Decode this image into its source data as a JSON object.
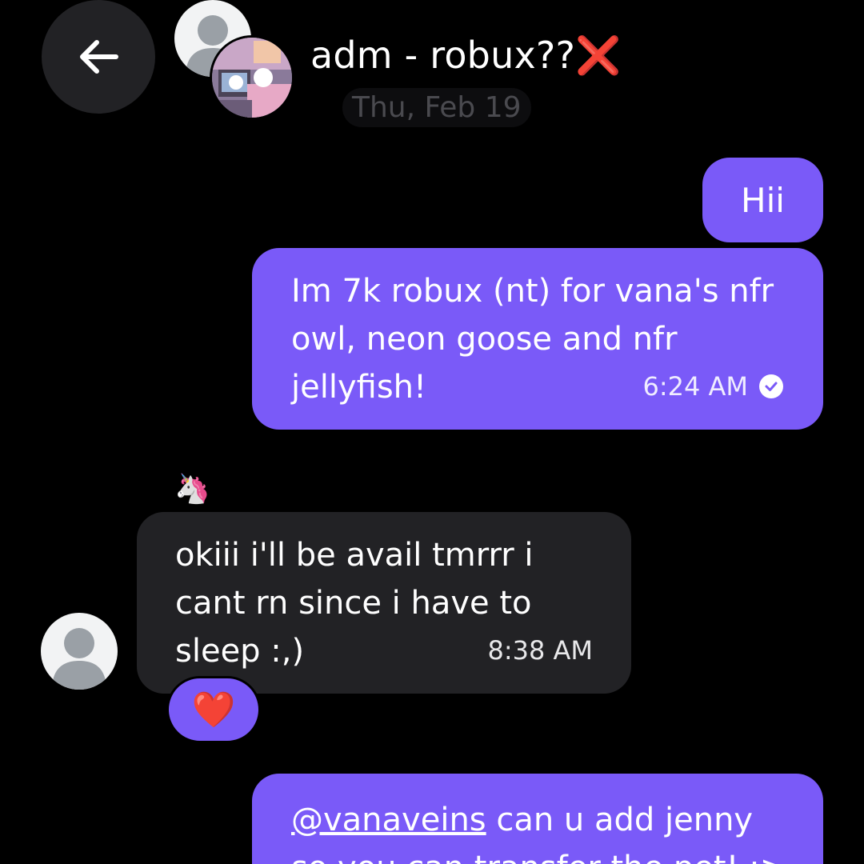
{
  "header": {
    "title": "adm - robux??",
    "title_emoji": "❌",
    "date": "Thu, Feb 19"
  },
  "messages": [
    {
      "direction": "outgoing",
      "text": "Hii"
    },
    {
      "direction": "outgoing",
      "text": "Im 7k robux (nt) for vana's nfr owl, neon goose and nfr jellyfish!",
      "time": "6:24 AM",
      "status": "read"
    },
    {
      "direction": "incoming",
      "sender_tag": "🦄",
      "text": "okiii i'll be avail tmrrr i cant rn since i have to sleep :,)",
      "time": "8:38 AM",
      "reaction": "❤️"
    },
    {
      "direction": "outgoing",
      "mention": "@vanaveins",
      "text": " can u add jenny so you can transfer the pet! :>"
    }
  ],
  "colors": {
    "outgoing_bubble": "#7a5af8",
    "incoming_bubble": "#222225",
    "background": "#000000"
  },
  "icons": {
    "back": "arrow-left-icon",
    "read_status": "check-circle-icon"
  }
}
